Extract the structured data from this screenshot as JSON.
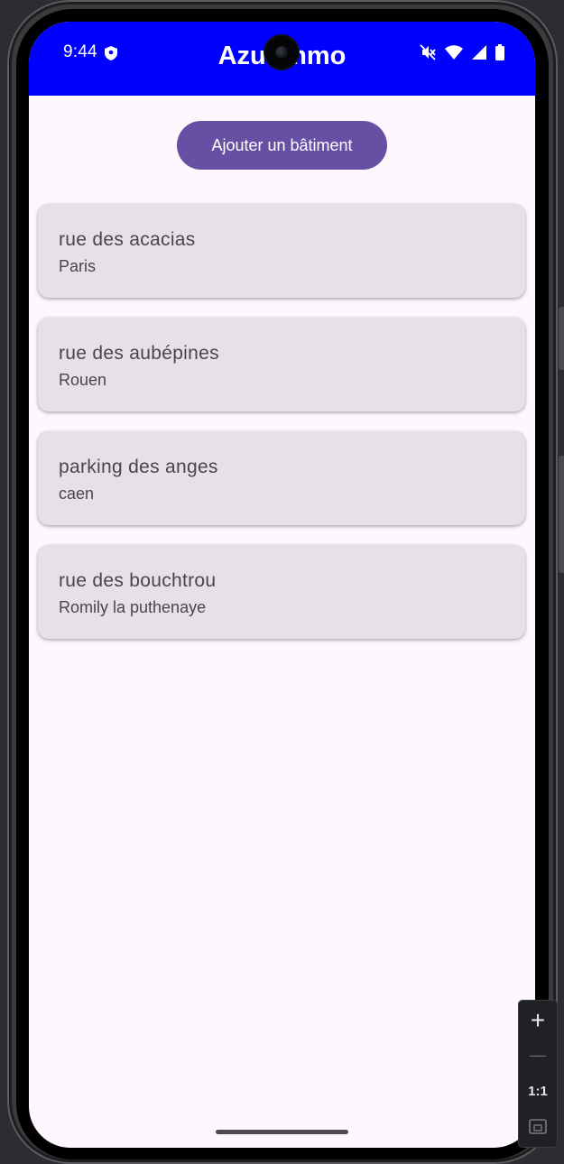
{
  "status_bar": {
    "time": "9:44",
    "icons": [
      "vpn-shield-icon",
      "mute-icon",
      "wifi-icon",
      "signal-icon",
      "battery-icon"
    ]
  },
  "app": {
    "title": "Azurimmo",
    "bar_color": "#0000ff"
  },
  "actions": {
    "add_building_label": "Ajouter un bâtiment",
    "accent": "#6750a4"
  },
  "buildings": [
    {
      "street": "rue des acacias",
      "city": "Paris"
    },
    {
      "street": "rue des aubépines",
      "city": "Rouen"
    },
    {
      "street": "parking des anges",
      "city": "caen"
    },
    {
      "street": "rue des bouchtrou",
      "city": "Romily la puthenaye"
    }
  ],
  "emulator_zoom": {
    "zoom_in": "+",
    "zoom_out": "—",
    "actual_size": "1:1",
    "fit_icon": "fit-screen-icon"
  }
}
